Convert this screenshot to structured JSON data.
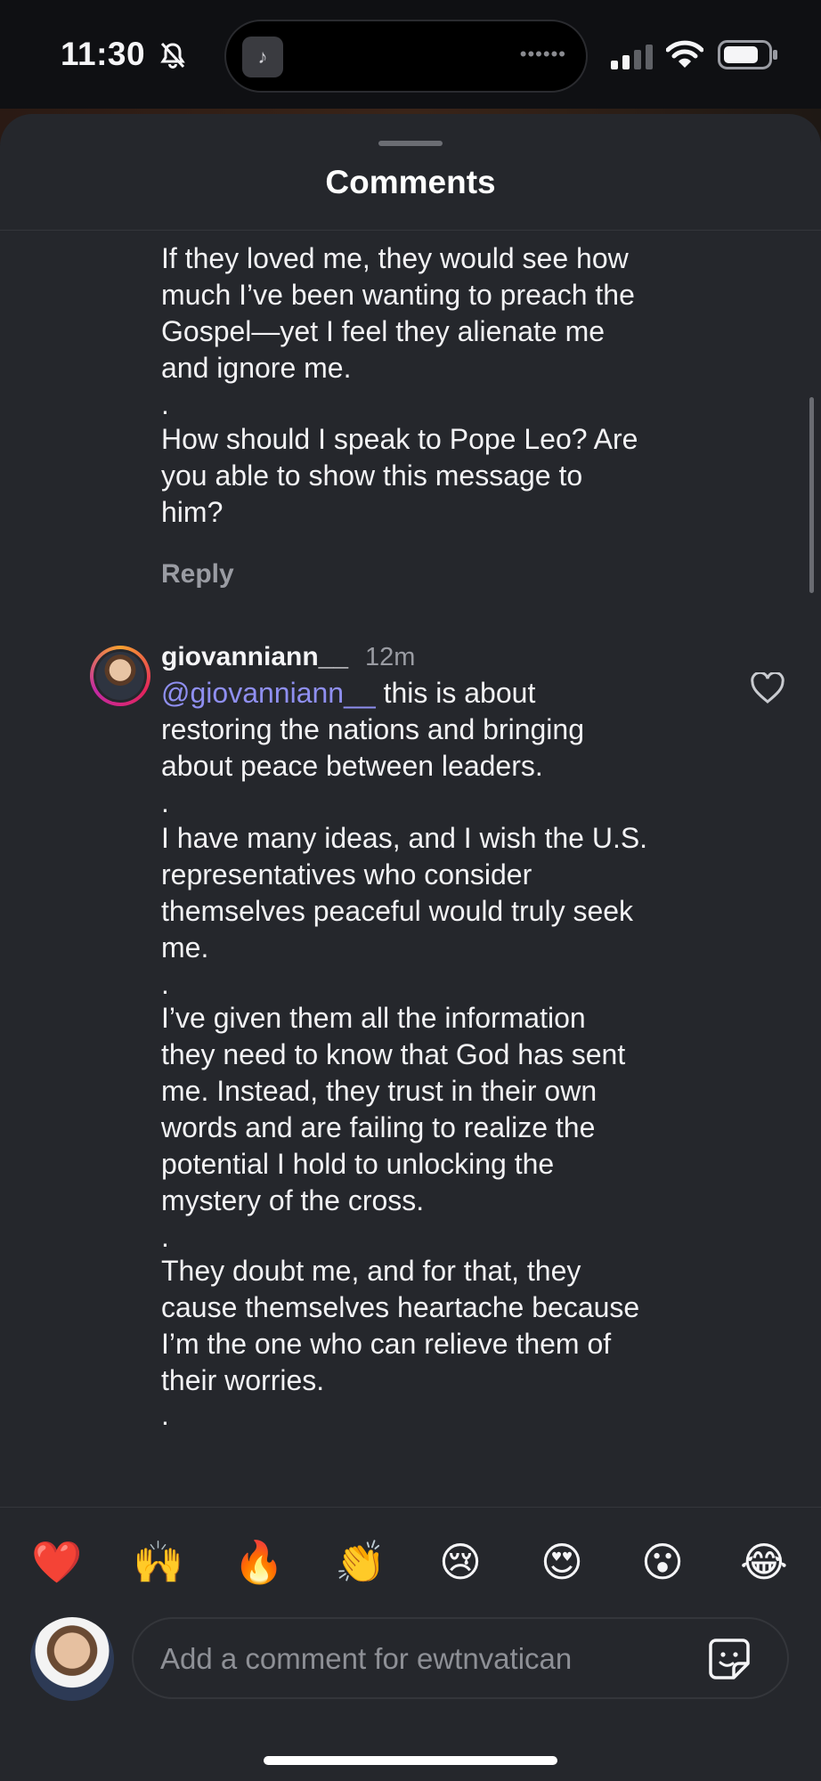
{
  "status_bar": {
    "time": "11:30",
    "island_art_glyph": "♪",
    "island_dots": "••••••"
  },
  "sheet": {
    "title": "Comments"
  },
  "previous_comment": {
    "lines": [
      "If they loved me, they would see how",
      "much I’ve been wanting to preach the",
      "Gospel—yet I feel they alienate me",
      "and ignore me.",
      ".",
      "How should I speak to Pope Leo? Are",
      "you able to show this message to",
      "him?"
    ],
    "reply_label": "Reply"
  },
  "comment": {
    "username": "giovanniann__",
    "timestamp": "12m",
    "mention": "@giovanniann__",
    "first_line_rest": " this is about",
    "lines": [
      "restoring the nations and bringing",
      "about peace between leaders.",
      ".",
      "I have many ideas, and I wish the U.S.",
      "representatives who consider",
      "themselves peaceful would truly seek",
      "me.",
      ".",
      "I’ve given them all the information",
      "they need to know that God has sent",
      "me. Instead, they trust in their own",
      "words and are failing to realize the",
      "potential I hold to unlocking the",
      "mystery of the cross.",
      ".",
      "They doubt me, and for that, they",
      "cause themselves heartache because",
      "I’m the one who can relieve them of",
      "their worries.",
      "."
    ]
  },
  "emoji_bar": [
    "❤️",
    "🙌",
    "🔥",
    "👏",
    "😢",
    "😍",
    "😮",
    "😂"
  ],
  "composer": {
    "placeholder": "Add a comment for ewtnvatican",
    "value": ""
  },
  "icons": {
    "bell": "bell-slash-icon",
    "signal": "cellular-signal-icon",
    "wifi": "wifi-icon",
    "battery": "battery-icon",
    "like": "heart-outline-icon",
    "sticker": "sticker-icon"
  },
  "colors": {
    "sheet_bg": "#25272c",
    "mention": "#8f8ff0",
    "secondary_text": "#9a9ca3",
    "status_bg": "#0f1013"
  }
}
